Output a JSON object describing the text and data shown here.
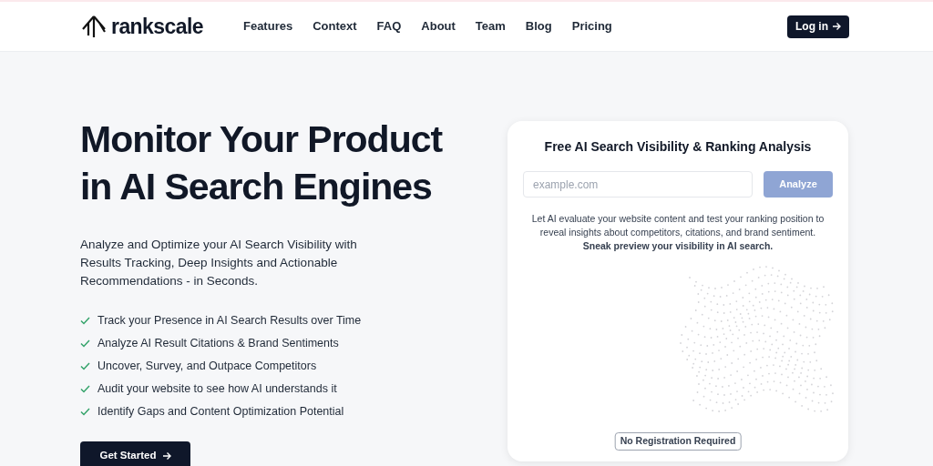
{
  "header": {
    "logo": "rankscale",
    "nav": [
      "Features",
      "Context",
      "FAQ",
      "About",
      "Team",
      "Blog",
      "Pricing"
    ],
    "login": "Log in"
  },
  "hero": {
    "title_lines": [
      "Monitor Your Product",
      "in AI Search Engines"
    ],
    "subtitle": "Analyze and Optimize your AI Search Visibility with Results Tracking, Deep Insights and Actionable Recommendations - in Seconds.",
    "features": [
      "Track your Presence in AI Search Results over Time",
      "Analyze AI Result Citations & Brand Sentiments",
      "Uncover, Survey, and Outpace Competitors",
      "Audit your website to see how AI understands it",
      "Identify Gaps and Content Optimization Potential"
    ],
    "cta": "Get Started"
  },
  "card": {
    "title": "Free AI Search Visibility & Ranking Analysis",
    "input": {
      "placeholder": "example.com"
    },
    "button": {
      "label": "Analyze",
      "disabled": true
    },
    "description": "Let AI evaluate your website content and test your ranking position to reveal insights about competitors, citations, and brand sentiment. **Sneak preview your visibility in AI search.**",
    "note": "No Registration Required"
  }
}
